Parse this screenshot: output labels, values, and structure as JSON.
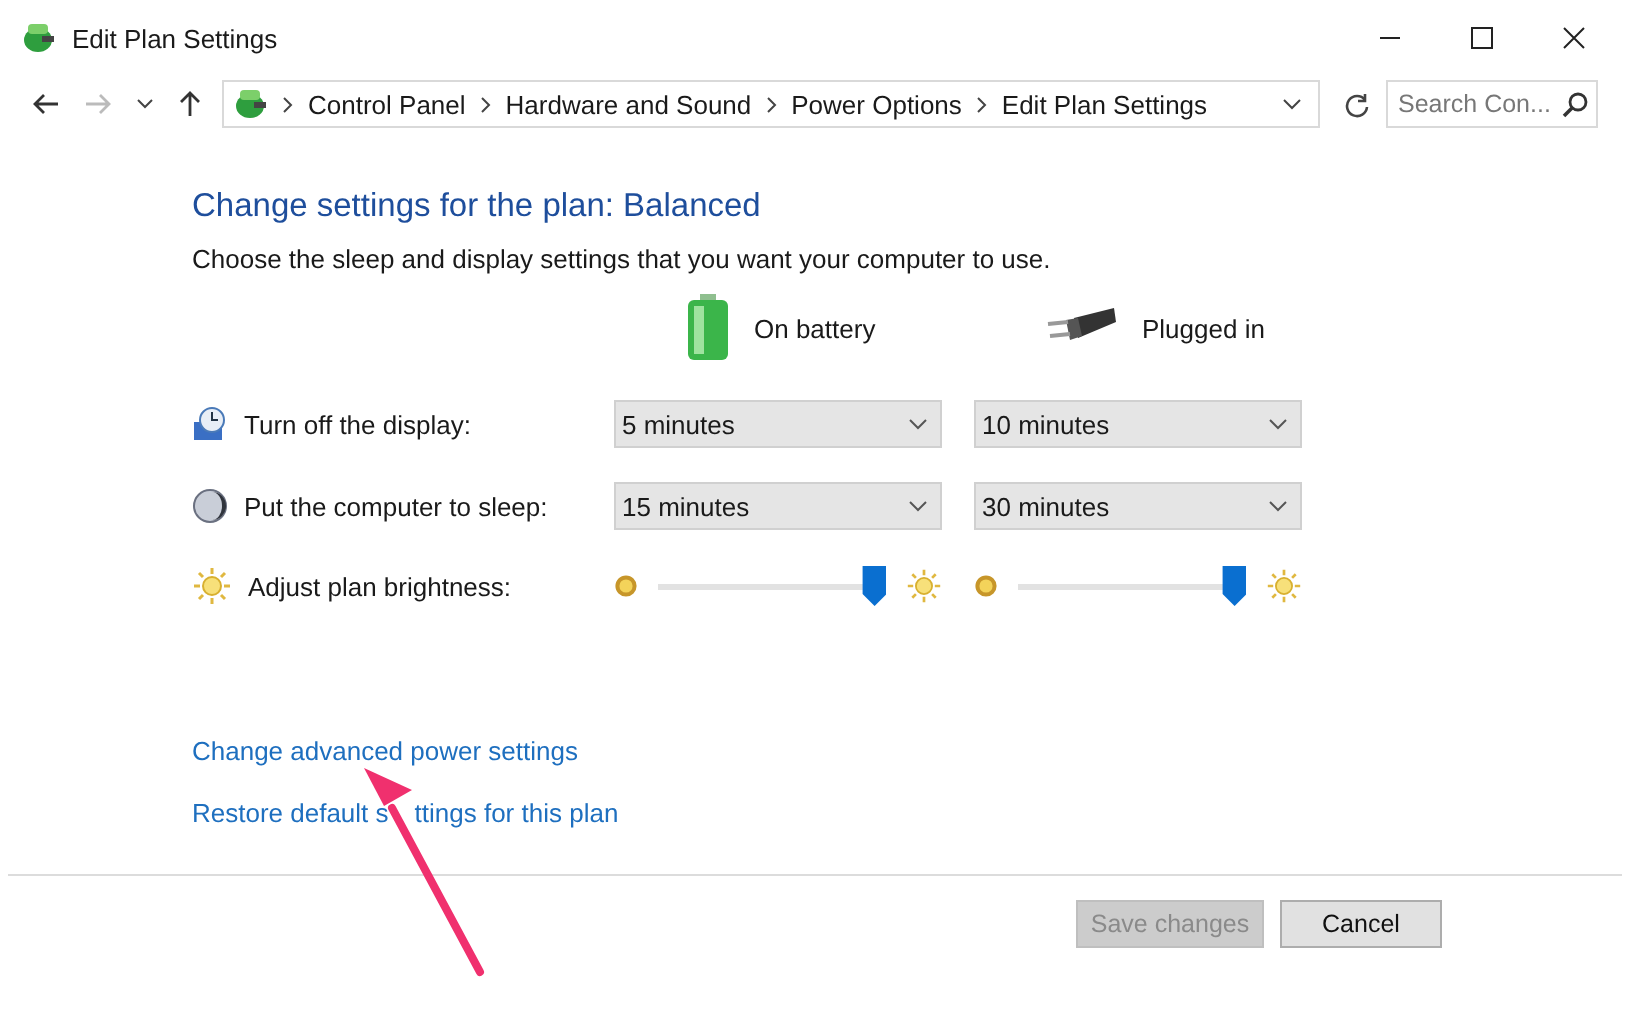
{
  "window": {
    "title": "Edit Plan Settings"
  },
  "address_bar": {
    "breadcrumbs": [
      "Control Panel",
      "Hardware and Sound",
      "Power Options",
      "Edit Plan Settings"
    ]
  },
  "search": {
    "placeholder": "Search Con..."
  },
  "heading": "Change settings for the plan: Balanced",
  "description": "Choose the sleep and display settings that you want your computer to use.",
  "columns": [
    {
      "label": "On battery",
      "kind": "battery"
    },
    {
      "label": "Plugged in",
      "kind": "plug"
    }
  ],
  "settings": [
    {
      "label": "Turn off the display:",
      "kind": "display",
      "values": [
        "5 minutes",
        "10 minutes"
      ]
    },
    {
      "label": "Put the computer to sleep:",
      "kind": "sleep",
      "values": [
        "15 minutes",
        "30 minutes"
      ]
    },
    {
      "label": "Adjust plan brightness:",
      "kind": "brightness",
      "sliders": [
        {
          "level": 0.95
        },
        {
          "level": 0.95
        }
      ]
    }
  ],
  "links": [
    {
      "parts": [
        "Change advanced power settings"
      ]
    },
    {
      "parts": [
        "Restore default s",
        "ttings for this plan"
      ]
    }
  ],
  "buttons": [
    {
      "label": "Save changes",
      "disabled": true
    },
    {
      "label": "Cancel",
      "disabled": false
    }
  ]
}
